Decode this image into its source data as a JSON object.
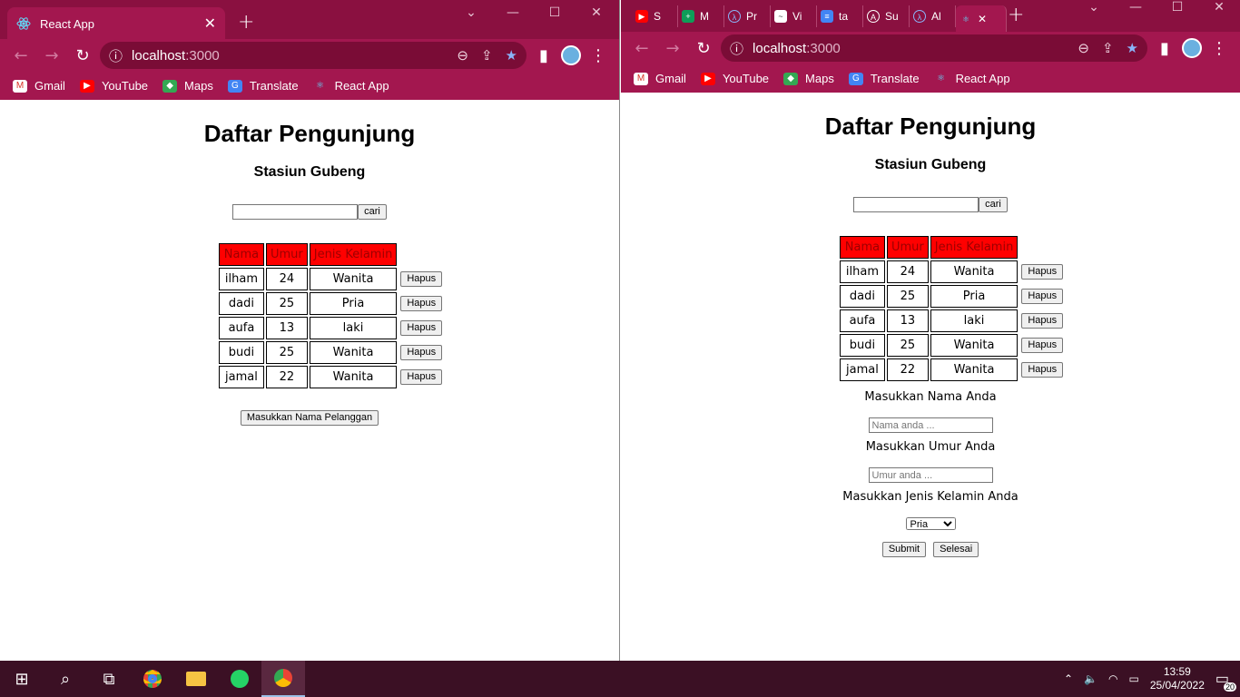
{
  "left_window": {
    "tab_title": "React App",
    "url_host": "localhost",
    "url_port": ":3000",
    "bookmarks": [
      "Gmail",
      "YouTube",
      "Maps",
      "Translate",
      "React App"
    ],
    "page": {
      "title": "Daftar Pengunjung",
      "subtitle": "Stasiun Gubeng",
      "search_button": "cari",
      "columns": [
        "Nama",
        "Umur",
        "Jenis Kelamin"
      ],
      "rows": [
        {
          "nama": "ilham",
          "umur": "24",
          "jk": "Wanita"
        },
        {
          "nama": "dadi",
          "umur": "25",
          "jk": "Pria"
        },
        {
          "nama": "aufa",
          "umur": "13",
          "jk": "laki"
        },
        {
          "nama": "budi",
          "umur": "25",
          "jk": "Wanita"
        },
        {
          "nama": "jamal",
          "umur": "22",
          "jk": "Wanita"
        }
      ],
      "delete_label": "Hapus",
      "add_button": "Masukkan Nama Pelanggan"
    }
  },
  "right_window": {
    "tabs": [
      "S",
      "M",
      "Pr",
      "Vi",
      "ta",
      "Su",
      "Al"
    ],
    "url_host": "localhost",
    "url_port": ":3000",
    "bookmarks": [
      "Gmail",
      "YouTube",
      "Maps",
      "Translate",
      "React App"
    ],
    "page": {
      "title": "Daftar Pengunjung",
      "subtitle": "Stasiun Gubeng",
      "search_button": "cari",
      "columns": [
        "Nama",
        "Umur",
        "Jenis Kelamin"
      ],
      "rows": [
        {
          "nama": "ilham",
          "umur": "24",
          "jk": "Wanita"
        },
        {
          "nama": "dadi",
          "umur": "25",
          "jk": "Pria"
        },
        {
          "nama": "aufa",
          "umur": "13",
          "jk": "laki"
        },
        {
          "nama": "budi",
          "umur": "25",
          "jk": "Wanita"
        },
        {
          "nama": "jamal",
          "umur": "22",
          "jk": "Wanita"
        }
      ],
      "delete_label": "Hapus",
      "form": {
        "name_label": "Masukkan Nama Anda",
        "name_placeholder": "Nama anda ...",
        "age_label": "Masukkan Umur Anda",
        "age_placeholder": "Umur anda ...",
        "gender_label": "Masukkan Jenis Kelamin Anda",
        "gender_selected": "Pria",
        "submit_label": "Submit",
        "done_label": "Selesai"
      }
    }
  },
  "taskbar": {
    "time": "13:59",
    "date": "25/04/2022",
    "notification_count": "20"
  },
  "colors": {
    "chrome_frame": "#a3174f",
    "tab_strip": "#8a1040",
    "table_header_bg": "#ff0000",
    "taskbar": "#3b1024"
  }
}
